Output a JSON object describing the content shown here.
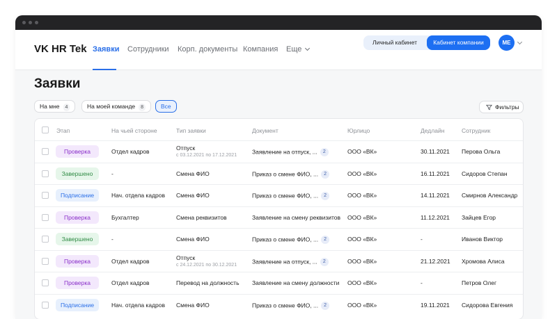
{
  "app": {
    "brand": "VK HR Tek"
  },
  "nav": {
    "items": [
      "Заявки",
      "Сотрудники",
      "Корп. документы",
      "Компания",
      "Еще"
    ],
    "active": "Заявки"
  },
  "header": {
    "personal_cabinet": "Личный кабинет",
    "company_cabinet": "Кабинет компании",
    "avatar_initials": "ME"
  },
  "page": {
    "title": "Заявки"
  },
  "filters": {
    "chips": [
      {
        "label": "На мне",
        "count": "4"
      },
      {
        "label": "На моей команде",
        "count": "8"
      },
      {
        "label": "Все",
        "count": ""
      }
    ],
    "selected": "Все",
    "filter_button": "Фильтры"
  },
  "table": {
    "columns": [
      "Этап",
      "На чьей стороне",
      "Тип заявки",
      "Документ",
      "Юрлицо",
      "Дедлайн",
      "Сотрудник"
    ],
    "rows": [
      {
        "stage": "Проверка",
        "stage_color": "purple",
        "side": "Отдел кадров",
        "type": "Отпуск",
        "type_sub": "с 03.12.2021 по 17.12.2021",
        "document": "Заявление на отпуск, ...",
        "doc_count": "2",
        "entity": "ООО «ВК»",
        "deadline": "30.11.2021",
        "employee": "Перова Ольга"
      },
      {
        "stage": "Завершено",
        "stage_color": "green",
        "side": "-",
        "type": "Смена ФИО",
        "type_sub": "",
        "document": "Приказ о смене ФИО, ...",
        "doc_count": "2",
        "entity": "ООО «ВК»",
        "deadline": "16.11.2021",
        "employee": "Сидоров Степан"
      },
      {
        "stage": "Подписание",
        "stage_color": "blue",
        "side": "Нач. отдела кадров",
        "type": "Смена ФИО",
        "type_sub": "",
        "document": "Приказ о смене ФИО, ...",
        "doc_count": "2",
        "entity": "ООО «ВК»",
        "deadline": "14.11.2021",
        "employee": "Смирнов Александр"
      },
      {
        "stage": "Проверка",
        "stage_color": "purple",
        "side": "Бухгалтер",
        "type": "Смена реквизитов",
        "type_sub": "",
        "document": "Заявление на смену реквизитов",
        "doc_count": "",
        "entity": "ООО «ВК»",
        "deadline": "11.12.2021",
        "employee": "Зайцев Егор"
      },
      {
        "stage": "Завершено",
        "stage_color": "green",
        "side": "-",
        "type": "Смена ФИО",
        "type_sub": "",
        "document": "Приказ о смене ФИО, ...",
        "doc_count": "2",
        "entity": "ООО «ВК»",
        "deadline": "-",
        "employee": "Иванов Виктор"
      },
      {
        "stage": "Проверка",
        "stage_color": "purple",
        "side": "Отдел кадров",
        "type": "Отпуск",
        "type_sub": "с 24.12.2021 по 30.12.2021",
        "document": "Заявление на отпуск, ...",
        "doc_count": "2",
        "entity": "ООО «ВК»",
        "deadline": "21.12.2021",
        "employee": "Хромова Алиса"
      },
      {
        "stage": "Проверка",
        "stage_color": "purple",
        "side": "Отдел кадров",
        "type": "Перевод на должность",
        "type_sub": "",
        "document": "Заявление на смену должности",
        "doc_count": "",
        "entity": "ООО «ВК»",
        "deadline": "-",
        "employee": "Петров Олег"
      },
      {
        "stage": "Подписание",
        "stage_color": "blue",
        "side": "Нач. отдела кадров",
        "type": "Смена ФИО",
        "type_sub": "",
        "document": "Приказ о смене ФИО, ...",
        "doc_count": "2",
        "entity": "ООО «ВК»",
        "deadline": "19.11.2021",
        "employee": "Сидорова Евгения"
      }
    ]
  },
  "colors": {
    "accent": "#1d6ff2",
    "purple_badge": "#8a2fc9",
    "green_badge": "#2f8a44",
    "blue_badge": "#2a6fe8"
  }
}
